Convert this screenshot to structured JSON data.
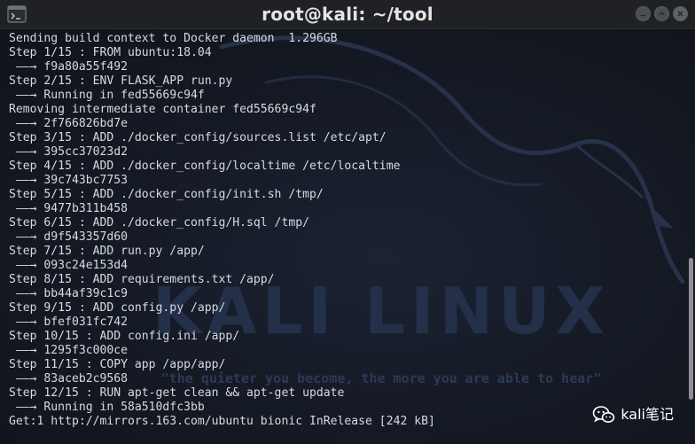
{
  "window": {
    "title": "root@kali: ~/tool",
    "controls": [
      "minimize",
      "maximize",
      "close"
    ]
  },
  "terminal": {
    "lines": [
      "Sending build context to Docker daemon  1.296GB",
      "Step 1/15 : FROM ubuntu:18.04",
      " ——→ f9a80a55f492",
      "Step 2/15 : ENV FLASK_APP run.py",
      " ——→ Running in fed55669c94f",
      "Removing intermediate container fed55669c94f",
      " ——→ 2f766826bd7e",
      "Step 3/15 : ADD ./docker_config/sources.list /etc/apt/",
      " ——→ 395cc37023d2",
      "Step 4/15 : ADD ./docker_config/localtime /etc/localtime",
      " ——→ 39c743bc7753",
      "Step 5/15 : ADD ./docker_config/init.sh /tmp/",
      " ——→ 9477b311b458",
      "Step 6/15 : ADD ./docker_config/H.sql /tmp/",
      " ——→ d9f543357d60",
      "Step 7/15 : ADD run.py /app/",
      " ——→ 093c24e153d4",
      "Step 8/15 : ADD requirements.txt /app/",
      " ——→ bb44af39c1c9",
      "Step 9/15 : ADD config.py /app/",
      " ——→ bfef031fc742",
      "Step 10/15 : ADD config.ini /app/",
      " ——→ 1295f3c000ce",
      "Step 11/15 : COPY app /app/app/",
      " ——→ 83aceb2c9568",
      "Step 12/15 : RUN apt-get clean && apt-get update",
      " ——→ Running in 58a510dfc3bb",
      "Get:1 http://mirrors.163.com/ubuntu bionic InRelease [242 kB]"
    ],
    "background": {
      "brand": "KALI LINUX",
      "tagline": "\"the quieter you become, the more you are able to hear\""
    }
  },
  "watermark": {
    "text": "kali笔记",
    "icon": "wechat-icon"
  },
  "colors": {
    "titlebar": "#202125",
    "terminal_bg": "#141923",
    "text": "#d7dae0"
  }
}
